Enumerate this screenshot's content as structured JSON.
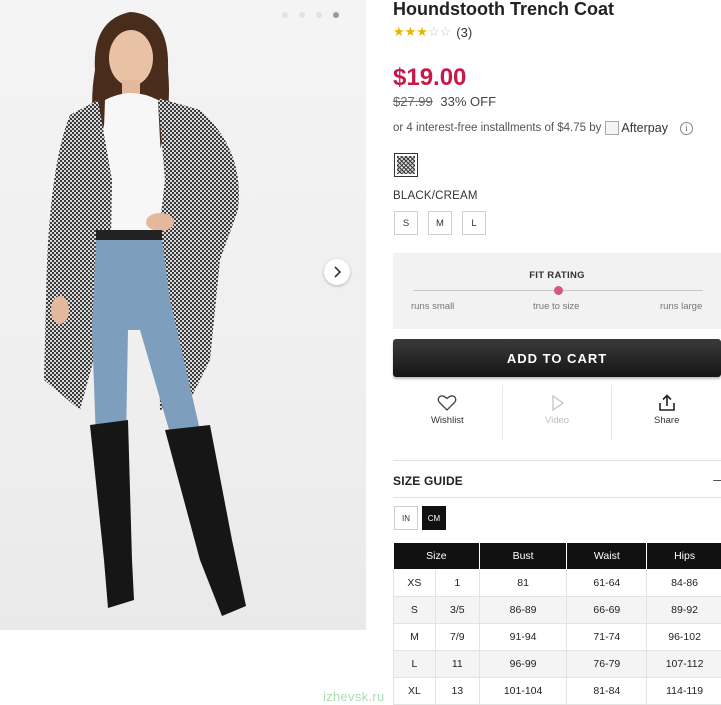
{
  "product": {
    "title": "Houndstooth Trench Coat",
    "rating_stars": 3,
    "rating_max": 5,
    "review_count": "(3)",
    "price": "$19.00",
    "original_price": "$27.99",
    "discount": "33% OFF",
    "installments_text": "or 4 interest-free installments of $4.75 by",
    "afterpay_label": "Afterpay",
    "info_icon": "i",
    "color_name": "BLACK/CREAM",
    "sizes": [
      "S",
      "M",
      "L"
    ]
  },
  "gallery": {
    "slide_count": 4,
    "active_slide": 4,
    "next_icon": "chevron-right-icon"
  },
  "fit_rating": {
    "title": "FIT RATING",
    "labels": [
      "runs small",
      "true to size",
      "runs large"
    ],
    "value": 0.5,
    "accent_color": "#d6587e"
  },
  "cart": {
    "add_to_cart_label": "ADD TO CART"
  },
  "actions": [
    {
      "label": "Wishlist",
      "icon": "heart-icon",
      "enabled": true
    },
    {
      "label": "Video",
      "icon": "play-icon",
      "enabled": false
    },
    {
      "label": "Share",
      "icon": "share-icon",
      "enabled": true
    }
  ],
  "size_guide": {
    "title": "SIZE GUIDE",
    "toggle": "–",
    "units": [
      "IN",
      "CM"
    ],
    "active_unit": "CM",
    "headers": [
      "Size",
      "Bust",
      "Waist",
      "Hips"
    ],
    "rows": [
      [
        "XS",
        "1",
        "81",
        "61-64",
        "84-86"
      ],
      [
        "S",
        "3/5",
        "86-89",
        "66-69",
        "89-92"
      ],
      [
        "M",
        "7/9",
        "91-94",
        "71-74",
        "96-102"
      ],
      [
        "L",
        "11",
        "96-99",
        "76-79",
        "107-112"
      ],
      [
        "XL",
        "13",
        "101-104",
        "81-84",
        "114-119"
      ]
    ]
  },
  "watermark": "izhevsk.ru",
  "colors": {
    "price": "#c8194a",
    "star": "#e8b400",
    "button": "#151515"
  }
}
